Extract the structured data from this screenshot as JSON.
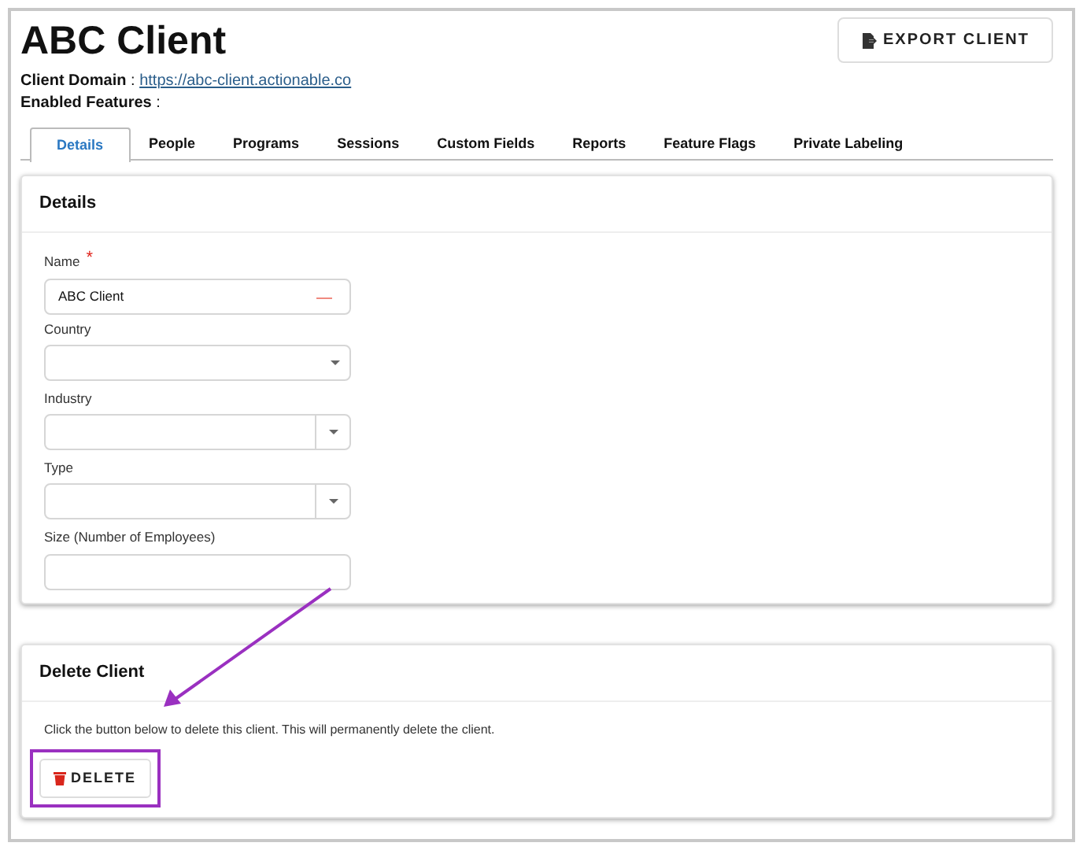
{
  "title": "ABC Client",
  "export_button": "EXPORT CLIENT",
  "client_domain": {
    "label": "Client Domain",
    "separator": ":",
    "value": "https://abc-client.actionable.co"
  },
  "enabled_features": {
    "label": "Enabled Features",
    "separator": ":"
  },
  "tabs": [
    {
      "label": "Details",
      "selected": true
    },
    {
      "label": "People",
      "selected": false
    },
    {
      "label": "Programs",
      "selected": false
    },
    {
      "label": "Sessions",
      "selected": false
    },
    {
      "label": "Custom Fields",
      "selected": false
    },
    {
      "label": "Reports",
      "selected": false
    },
    {
      "label": "Feature Flags",
      "selected": false
    },
    {
      "label": "Private Labeling",
      "selected": false
    }
  ],
  "details_card": {
    "title": "Details",
    "fields": [
      {
        "label": "Name",
        "required": true,
        "required_mark": "*",
        "kind": "text",
        "value": "ABC Client"
      },
      {
        "label": "Country",
        "required": false,
        "kind": "select"
      },
      {
        "label": "Industry",
        "required": false,
        "kind": "split-select"
      },
      {
        "label": "Type",
        "required": false,
        "kind": "split-select"
      },
      {
        "label": "Size (Number of Employees)",
        "required": false,
        "kind": "text"
      }
    ]
  },
  "delete_card": {
    "title": "Delete Client",
    "text": "Click the button below to delete this client. This will permanently delete the client.",
    "button": "DELETE"
  }
}
